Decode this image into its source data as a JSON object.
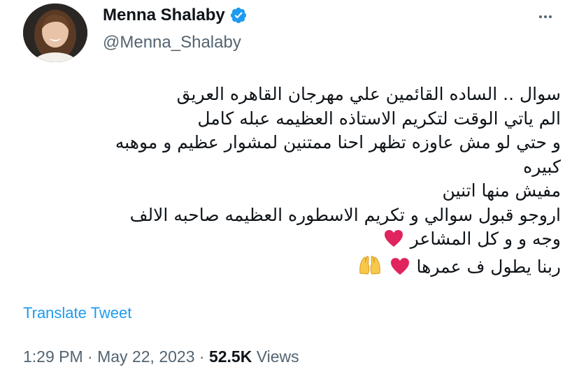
{
  "author": {
    "display_name": "Menna Shalaby",
    "handle": "@Menna_Shalaby",
    "verified": true,
    "avatar_icon": "profile-photo",
    "verified_color": "#1d9bf0"
  },
  "tweet": {
    "lines": [
      "سوال .. الساده القائمين علي مهرجان القاهره العريق",
      "الم ياتي الوقت لتكريم الاستاذه العظيمه عبله كامل",
      "و حتي لو مش عاوزه تظهر احنا ممتنين لمشوار عظيم و موهبه",
      "كبيره",
      "مفيش منها اتنين",
      "اروجو قبول سوالي و تكريم الاسطوره العظيمه صاحبه الالف"
    ],
    "line7_text": "وجه و و كل المشاعر",
    "line8_text": "ربنا يطول ف عمرها",
    "emojis": {
      "heart": "red-heart-icon",
      "hands": "raising-hands-icon"
    }
  },
  "translate_label": "Translate Tweet",
  "meta": {
    "time": "1:29 PM",
    "separator": " · ",
    "date": "May 22, 2023",
    "views_count": "52.5K",
    "views_label": " Views"
  },
  "colors": {
    "link": "#1d9bf0",
    "secondary": "#536471",
    "primary": "#0f1419",
    "heart": "#e0245e"
  }
}
